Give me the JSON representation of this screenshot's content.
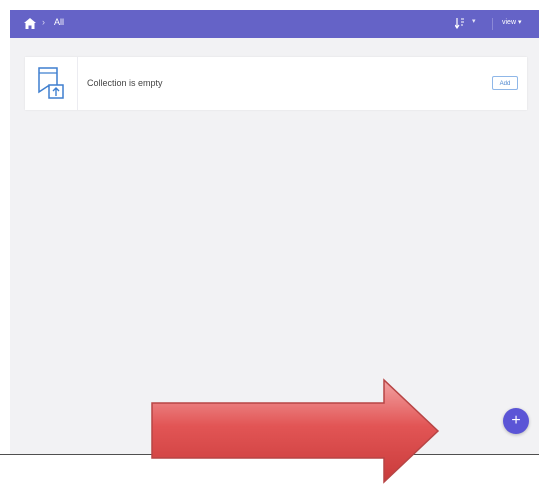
{
  "topbar": {
    "breadcrumb_separator": "›",
    "breadcrumb_current": "All",
    "view_label": "view ▾",
    "sort_caret": "▾"
  },
  "card": {
    "message": "Collection is empty",
    "add_label": "Add"
  },
  "fab": {
    "label": "+"
  },
  "icons": {
    "home": "home-icon",
    "sort": "sort-icon",
    "collection": "collection-upload-icon",
    "arrow": "red-right-arrow"
  },
  "colors": {
    "topbar": "#6563c7",
    "background": "#f2f2f4",
    "fab": "#5b55d6",
    "arrow_red": "#e25555",
    "add_border": "#8fb7e8"
  }
}
